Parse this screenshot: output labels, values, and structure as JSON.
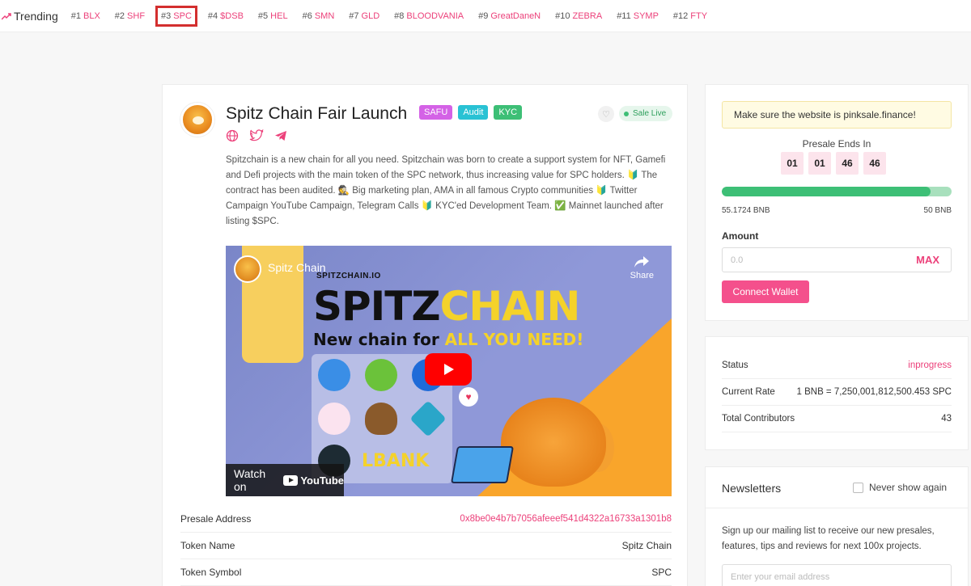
{
  "trending": {
    "title": "Trending",
    "items": [
      {
        "rank": "#1",
        "symbol": "BLX"
      },
      {
        "rank": "#2",
        "symbol": "SHF"
      },
      {
        "rank": "#3",
        "symbol": "SPC"
      },
      {
        "rank": "#4",
        "symbol": "$DSB"
      },
      {
        "rank": "#5",
        "symbol": "HEL"
      },
      {
        "rank": "#6",
        "symbol": "SMN"
      },
      {
        "rank": "#7",
        "symbol": "GLD"
      },
      {
        "rank": "#8",
        "symbol": "BLOODVANIA"
      },
      {
        "rank": "#9",
        "symbol": "GreatDaneN"
      },
      {
        "rank": "#10",
        "symbol": "ZEBRA"
      },
      {
        "rank": "#11",
        "symbol": "SYMP"
      },
      {
        "rank": "#12",
        "symbol": "FTY"
      }
    ]
  },
  "project": {
    "title": "Spitz Chain Fair Launch",
    "badges": {
      "safu": "SAFU",
      "audit": "Audit",
      "kyc": "KYC"
    },
    "status_badge": "Sale Live",
    "description": "Spitzchain is a new chain for all you need. Spitzchain was born to create a support system for NFT, Gamefi and Defi projects with the main token of the SPC network, thus increasing value for SPC holders. 🔰 The contract has been audited. 🕵 Big marketing plan, AMA in all famous Crypto communities 🔰 Twitter Campaign YouTube Campaign, Telegram Calls 🔰 KYC'ed Development Team. ✅ Mainnet launched after listing $SPC.",
    "video": {
      "channel_title": "Spitz Chain",
      "share_label": "Share",
      "site": "SPITZCHAIN.IO",
      "brand_a": "SPITZ",
      "brand_b": "CHAIN",
      "tagline_a": "New chain for ",
      "tagline_b": "ALL YOU NEED!",
      "lbank": "LBANK",
      "watch_on": "Watch on",
      "youtube": "YouTube"
    },
    "info": [
      {
        "label": "Presale Address",
        "value": "0x8be0e4b7b7056afeeef541d4322a16733a1301b8"
      },
      {
        "label": "Token Name",
        "value": "Spitz Chain"
      },
      {
        "label": "Token Symbol",
        "value": "SPC"
      }
    ]
  },
  "presale": {
    "warning": "Make sure the website is pinksale.finance!",
    "ends_label": "Presale Ends In",
    "timer": [
      "01",
      "01",
      "46",
      "46"
    ],
    "raised": "55.1724 BNB",
    "cap": "50 BNB",
    "progress_fraction": 0.91,
    "amount_label": "Amount",
    "amount_placeholder": "0.0",
    "max_label": "MAX",
    "connect_label": "Connect Wallet"
  },
  "stats": [
    {
      "label": "Status",
      "value": "inprogress"
    },
    {
      "label": "Current Rate",
      "value": "1 BNB = 7,250,001,812,500.453 SPC"
    },
    {
      "label": "Total Contributors",
      "value": "43"
    }
  ],
  "newsletter": {
    "title": "Newsletters",
    "checkbox_label": "Never show again",
    "text": "Sign up our mailing list to receive our new presales, features, tips and reviews for next 100x projects.",
    "email_placeholder": "Enter your email address"
  },
  "colors": {
    "accent": "#ec407a",
    "success": "#3dbf76",
    "highlight": "#d32f2f"
  }
}
